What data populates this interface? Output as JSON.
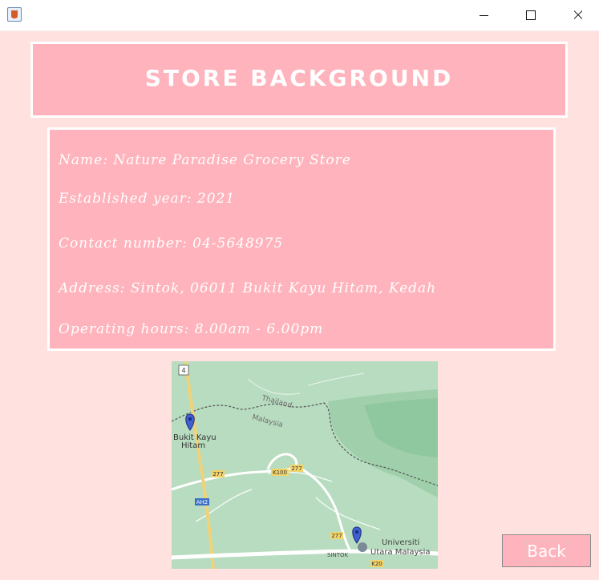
{
  "window": {
    "app_icon": "java-app-icon",
    "controls": [
      "minimize-icon",
      "maximize-icon",
      "close-icon"
    ]
  },
  "header": {
    "title": "STORE BACKGROUND"
  },
  "store_info": {
    "name": "Name: Nature Paradise Grocery Store",
    "established": "Established year: 2021",
    "contact": "Contact number: 04-5648975",
    "address": "Address: Sintok, 06011 Bukit Kayu Hitam, Kedah",
    "hours": "Operating hours: 8.00am - 6.00pm"
  },
  "map": {
    "labels": {
      "thailand": "Thailand",
      "malaysia": "Malaysia",
      "bukit": "Bukit Kayu",
      "hitam": "Hitam",
      "route4": "4",
      "r277a": "277",
      "r277b": "277",
      "r277c": "277",
      "k100": "K100",
      "ah2": "AH2",
      "k20": "K20",
      "sintok": "SINTOK",
      "uum1": "Universiti",
      "uum2": "Utara Malaysia"
    }
  },
  "actions": {
    "back_label": "Back"
  },
  "colors": {
    "background": "#ffe1df",
    "panel": "#ffb3bc",
    "panel_border": "#ffffff",
    "text": "#ffffff"
  }
}
